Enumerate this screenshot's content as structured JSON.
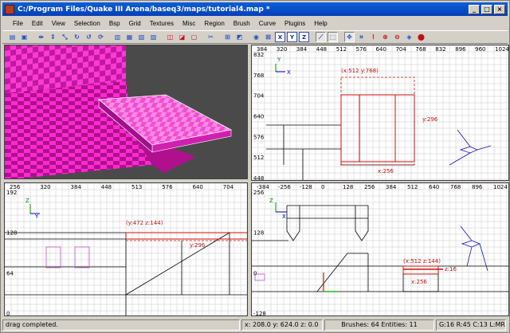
{
  "window": {
    "title": "C:/Program Files/Quake III Arena/baseq3/maps/tutorial4.map *",
    "minimize_label": "_",
    "maximize_label": "□",
    "close_label": "×"
  },
  "menu": [
    "File",
    "Edit",
    "View",
    "Selection",
    "Bsp",
    "Grid",
    "Textures",
    "Misc",
    "Region",
    "Brush",
    "Curve",
    "Plugins",
    "Help"
  ],
  "toolbar_icons": [
    "open-icon",
    "save-icon",
    "sep",
    "flip-x-icon",
    "flip-y-icon",
    "flip-z-icon",
    "rotate-x-icon",
    "rotate-y-icon",
    "rotate-z-icon",
    "sep",
    "select-complete-tall-icon",
    "select-touching-icon",
    "select-partial-tall-icon",
    "select-inside-icon",
    "sep",
    "csg-subtract-icon",
    "csg-merge-icon",
    "hollow-icon",
    "sep",
    "clipper-icon",
    "sep",
    "change-views-icon",
    "cubic-clip-icon",
    "sep",
    "camera-icon",
    "entity-icon",
    "x-axis-icon",
    "y-axis-icon",
    "z-axis-icon",
    "sep",
    "drag-edges-icon",
    "drag-vertices-icon",
    "sep",
    "show-patch-bounding-icon",
    "patch-wireframe-icon",
    "patch-bend-icon",
    "patch-insert-icon",
    "patch-delete-icon",
    "texture-lock-icon",
    "scale-lock-icon"
  ],
  "toolbar_box_labels": {
    "x-axis-icon": "X",
    "y-axis-icon": "Y",
    "z-axis-icon": "Z"
  },
  "views": {
    "top_right": {
      "x_labels": [
        "384",
        "320",
        "384",
        "448",
        "512",
        "576",
        "640",
        "704",
        "768",
        "832",
        "896",
        "960",
        "1024"
      ],
      "y_labels": [
        "832",
        "768",
        "704",
        "640",
        "576",
        "512",
        "448"
      ],
      "size_label_top": "(x:512  y:768)",
      "size_label_right": "y:296",
      "size_label_bottom": "x:256",
      "axis_x": "X",
      "axis_y": "Y"
    },
    "bottom_left": {
      "x_labels": [
        "256",
        "320",
        "384",
        "448",
        "513",
        "576",
        "640",
        "704"
      ],
      "y_labels": [
        "192",
        "128",
        "64",
        "0"
      ],
      "size_label_top": "(y:472  z:144)",
      "size_label_right": "y:296",
      "axis_x": "Y",
      "axis_y": "Z"
    },
    "bottom_right": {
      "x_labels": [
        "-384",
        "-256",
        "-128",
        "0",
        "128",
        "256",
        "384",
        "512",
        "640",
        "768",
        "896",
        "1024"
      ],
      "y_labels": [
        "256",
        "128",
        "0",
        "-128"
      ],
      "size_label_top": "(x:512  z:144)",
      "size_label_right": "z:16",
      "size_label_bottom": "x:256",
      "axis_x": "X",
      "axis_y": "Z"
    }
  },
  "status": {
    "message": "drag completed.",
    "coords": "x:  208.0  y:  624.0  z:  0.0",
    "counts": "Brushes: 64  Entities: 11",
    "grid": "G:16 R:45 C:13 L:MR"
  },
  "colors": {
    "selection_red": "#d01010",
    "grid_line": "#c8c8c8",
    "brush_line": "#000000",
    "texture_magenta": "#ff3ad4"
  }
}
